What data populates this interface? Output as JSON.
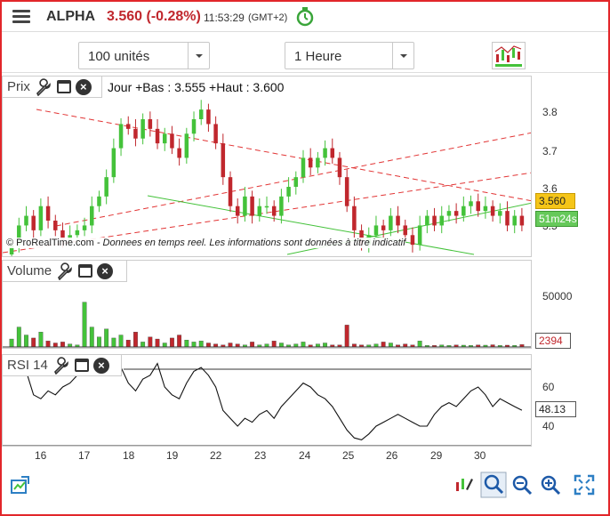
{
  "header": {
    "symbol": "ALPHA",
    "price_change": "3.560 (-0.28%)",
    "time": "11:53:29",
    "timezone": "(GMT+2)"
  },
  "controls": {
    "quantity": "100 unités",
    "timeframe": "1 Heure"
  },
  "price_panel": {
    "title": "Prix",
    "hilo": "Jour +Bas : 3.555 +Haut : 3.600",
    "y_ticks": [
      "3.8",
      "3.7",
      "3.6",
      "3.5"
    ],
    "last_price": "3.560",
    "countdown": "51m24s",
    "disclaimer_brand": "© ProRealTime.com",
    "disclaimer_text": " - Donnees en temps reel. Les informations sont données à titre indicatif"
  },
  "volume_panel": {
    "title": "Volume",
    "y_tick": "50000",
    "last_value": "2394"
  },
  "rsi_panel": {
    "title": "RSI 14",
    "y_ticks": [
      "60",
      "40"
    ],
    "last_value": "48.13"
  },
  "x_axis": {
    "labels": [
      "16",
      "17",
      "18",
      "19",
      "22",
      "23",
      "24",
      "25",
      "26",
      "29",
      "30"
    ]
  },
  "colors": {
    "up": "#44c23a",
    "down": "#c0272d",
    "accent": "#e2262a",
    "price_box": "#f5c518",
    "countdown_box": "#66c95a"
  },
  "chart_data": [
    {
      "type": "candlestick",
      "title": "Prix",
      "ylim": [
        3.5,
        3.85
      ],
      "close": [
        3.52,
        3.56,
        3.58,
        3.55,
        3.6,
        3.57,
        3.55,
        3.53,
        3.54,
        3.55,
        3.56,
        3.6,
        3.62,
        3.66,
        3.72,
        3.77,
        3.76,
        3.74,
        3.78,
        3.76,
        3.73,
        3.75,
        3.72,
        3.7,
        3.75,
        3.78,
        3.8,
        3.77,
        3.73,
        3.66,
        3.6,
        3.58,
        3.62,
        3.58,
        3.6,
        3.6,
        3.58,
        3.62,
        3.64,
        3.66,
        3.7,
        3.68,
        3.7,
        3.72,
        3.7,
        3.66,
        3.6,
        3.55,
        3.52,
        3.54,
        3.56,
        3.55,
        3.58,
        3.56,
        3.54,
        3.52,
        3.56,
        3.58,
        3.56,
        3.58,
        3.59,
        3.58,
        3.6,
        3.61,
        3.59,
        3.6,
        3.58,
        3.59,
        3.56,
        3.58,
        3.56
      ],
      "volume": [
        8000,
        20000,
        12000,
        9000,
        15000,
        6000,
        4000,
        5000,
        3000,
        2000,
        45000,
        20000,
        10000,
        18000,
        9000,
        12000,
        7000,
        15000,
        5000,
        10000,
        8000,
        4000,
        9000,
        12000,
        7000,
        5000,
        6000,
        4000,
        3000,
        2000,
        4000,
        3000,
        2000,
        5000,
        2000,
        3000,
        6000,
        4000,
        2000,
        3000,
        5000,
        2000,
        3000,
        4000,
        2000,
        2000,
        22000,
        3000,
        2000,
        2000,
        3000,
        5000,
        4000,
        2000,
        3000,
        2000,
        6000,
        1500,
        1500,
        2000,
        1500,
        2000,
        1800,
        1500,
        2000,
        1800,
        2200,
        1500,
        1800,
        1600,
        2394
      ],
      "rsi": [
        70,
        72,
        68,
        56,
        54,
        58,
        56,
        60,
        62,
        66,
        72,
        84,
        90,
        88,
        80,
        70,
        62,
        58,
        64,
        66,
        72,
        60,
        56,
        54,
        62,
        68,
        70,
        66,
        60,
        48,
        44,
        40,
        44,
        42,
        46,
        48,
        44,
        50,
        54,
        58,
        62,
        60,
        56,
        54,
        50,
        44,
        38,
        34,
        33,
        36,
        40,
        42,
        44,
        46,
        44,
        42,
        40,
        40,
        46,
        50,
        52,
        50,
        54,
        58,
        60,
        56,
        50,
        54,
        52,
        50,
        48.13
      ],
      "x_labels": [
        "16",
        "17",
        "18",
        "19",
        "22",
        "23",
        "24",
        "25",
        "26",
        "29",
        "30"
      ]
    }
  ]
}
